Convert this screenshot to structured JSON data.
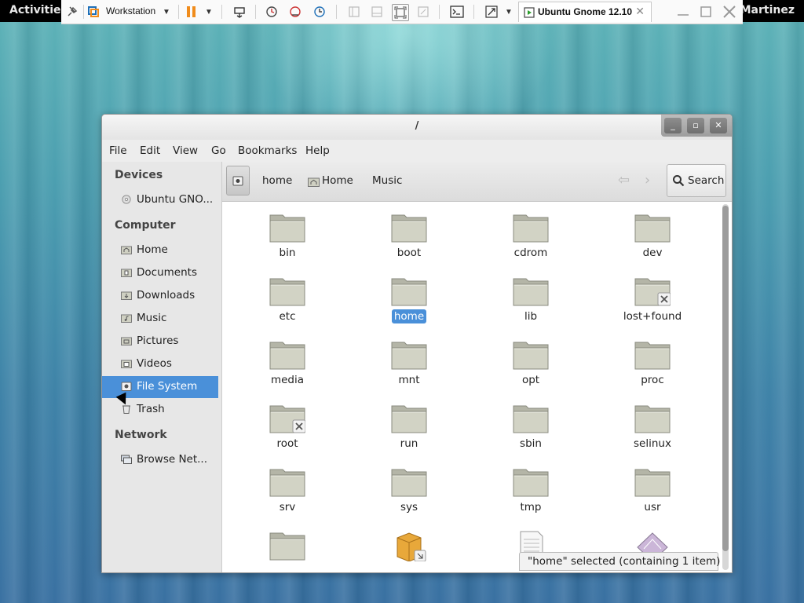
{
  "topbar": {
    "activities": "Activities",
    "user": "Martinez"
  },
  "vmware": {
    "vm_menu_label": "Workstation",
    "tab_title": "Ubuntu Gnome 12.10",
    "tab_close": "✕"
  },
  "window": {
    "title": "/",
    "menu": [
      "File",
      "Edit",
      "View",
      "Go",
      "Bookmarks",
      "Help"
    ]
  },
  "sidebar": {
    "sections": [
      {
        "heading": "Devices",
        "items": [
          {
            "label": "Ubuntu GNO...",
            "icon": "disc-icon"
          }
        ]
      },
      {
        "heading": "Computer",
        "items": [
          {
            "label": "Home",
            "icon": "home-folder-icon"
          },
          {
            "label": "Documents",
            "icon": "documents-folder-icon"
          },
          {
            "label": "Downloads",
            "icon": "downloads-folder-icon"
          },
          {
            "label": "Music",
            "icon": "music-folder-icon"
          },
          {
            "label": "Pictures",
            "icon": "pictures-folder-icon"
          },
          {
            "label": "Videos",
            "icon": "videos-folder-icon"
          },
          {
            "label": "File System",
            "icon": "drive-icon",
            "selected": true
          },
          {
            "label": "Trash",
            "icon": "trash-icon"
          }
        ]
      },
      {
        "heading": "Network",
        "items": [
          {
            "label": "Browse Net...",
            "icon": "network-icon"
          }
        ]
      }
    ]
  },
  "pathbar": {
    "crumbs": [
      "home",
      "Home",
      "Music"
    ],
    "search_label": "Search"
  },
  "files": [
    {
      "name": "bin"
    },
    {
      "name": "boot"
    },
    {
      "name": "cdrom"
    },
    {
      "name": "dev"
    },
    {
      "name": "etc"
    },
    {
      "name": "home",
      "selected": true
    },
    {
      "name": "lib"
    },
    {
      "name": "lost+found",
      "locked": true
    },
    {
      "name": "media"
    },
    {
      "name": "mnt"
    },
    {
      "name": "opt"
    },
    {
      "name": "proc"
    },
    {
      "name": "root",
      "locked": true
    },
    {
      "name": "run"
    },
    {
      "name": "sbin"
    },
    {
      "name": "selinux"
    },
    {
      "name": "srv"
    },
    {
      "name": "sys"
    },
    {
      "name": "tmp"
    },
    {
      "name": "usr"
    },
    {
      "name": "",
      "kind": "folder"
    },
    {
      "name": "",
      "kind": "package"
    },
    {
      "name": "",
      "kind": "document"
    },
    {
      "name": "",
      "kind": "image"
    }
  ],
  "status": "\"home\" selected (containing 1 item)",
  "colors": {
    "selection": "#4a90d9",
    "folder": "#d2d3c5",
    "folder_tab": "#b4b5a7"
  }
}
